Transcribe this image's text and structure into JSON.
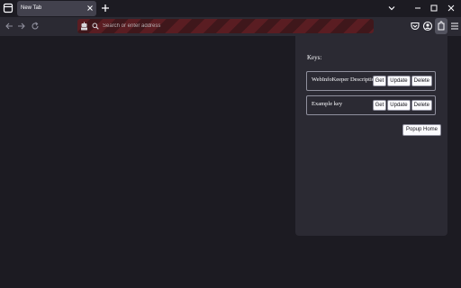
{
  "tab": {
    "title": "New Tab"
  },
  "urlbar": {
    "placeholder": "Search or enter address"
  },
  "popup": {
    "heading": "Keys:",
    "keys": [
      {
        "name": "WebInfoKeeper Description",
        "get": "Get",
        "update": "Update",
        "delete": "Delete"
      },
      {
        "name": "Example key",
        "get": "Get",
        "update": "Update",
        "delete": "Delete"
      }
    ],
    "home_label": "Popup Home"
  },
  "icons": {
    "tabs_menu": "list-tabs-icon",
    "tab_close": "close-icon",
    "new_tab": "plus-icon",
    "back": "back-arrow-icon",
    "forward": "forward-arrow-icon",
    "reload": "reload-icon",
    "privacy": "robot-icon",
    "search": "search-icon",
    "pocket": "pocket-icon",
    "account": "account-icon",
    "extension": "extension-icon",
    "menu": "hamburger-menu-icon"
  },
  "colors": {
    "accent": "#fbfbfe",
    "toolbar": "#2b2a33",
    "background": "#1c1b22",
    "private_stripe": "#5a1d22"
  }
}
